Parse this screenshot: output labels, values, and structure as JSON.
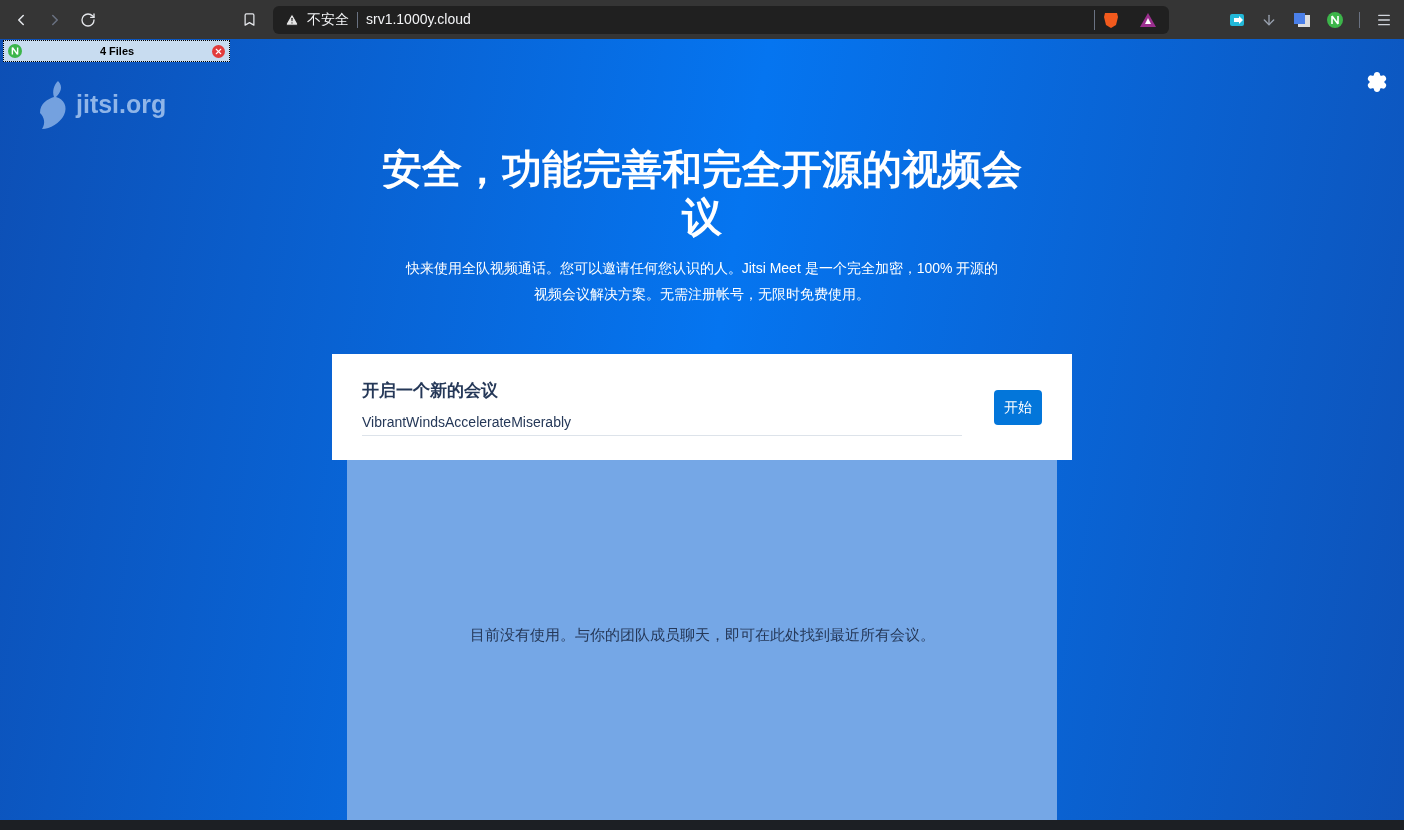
{
  "browser": {
    "security_label": "不安全",
    "url": "srv1.1000y.cloud"
  },
  "popup": {
    "title": "4 Files"
  },
  "logo": {
    "text": "jitsi.org"
  },
  "hero": {
    "title": "安全，功能完善和完全开源的视频会议",
    "description": "快来使用全队视频通话。您可以邀请任何您认识的人。Jitsi Meet 是一个完全加密，100% 开源的视频会议解决方案。无需注册帐号，无限时免费使用。"
  },
  "meeting_card": {
    "heading": "开启一个新的会议",
    "room_name": "VibrantWindsAccelerateMiserably",
    "button": "开始"
  },
  "recent": {
    "empty_message": "目前没有使用。与你的团队成员聊天，即可在此处找到最近所有会议。"
  }
}
